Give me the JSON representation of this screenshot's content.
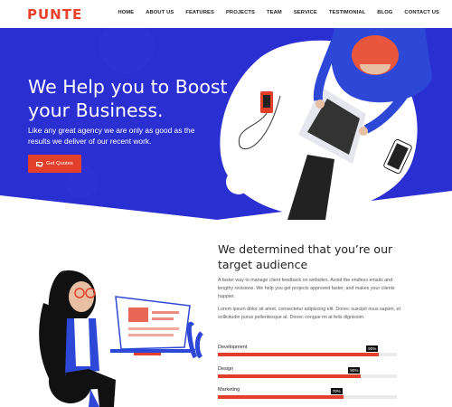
{
  "brand": {
    "logo": "PUNTE"
  },
  "nav": {
    "items": [
      "HOME",
      "ABOUT US",
      "FEATURES",
      "PROJECTS",
      "TEAM",
      "SERVICE",
      "TESTIMONIAL",
      "BLOG",
      "CONTACT US"
    ]
  },
  "hero": {
    "title": "We Help you to Boost your Business.",
    "subtitle": "Like any great agency we are only as good as the results we deliver of our recent work.",
    "cta": "Get Quotes",
    "bg_color": "#2a2fd1"
  },
  "section": {
    "title": "We determined that you’re our target audience",
    "para1": "A faster way to manage client feedback on websites. Avoid the endless emails and lengthy revisions. We help you get projects approved faster, and makes your clients happier.",
    "para2": "Lorem ipsum dolor sit amet, consectetur adipiscing elit. Donec suscipit risus sapien, et sollicitudin purus pellentesque at. Donec congue mi at felis dignissim.",
    "skills": [
      {
        "label": "Development",
        "percent": 90,
        "tip": "90%"
      },
      {
        "label": "Design",
        "percent": 80,
        "tip": "80%"
      },
      {
        "label": "Marketing",
        "percent": 70,
        "tip": "70%"
      }
    ]
  },
  "colors": {
    "accent": "#e2402a",
    "primary": "#2a2fd1"
  }
}
